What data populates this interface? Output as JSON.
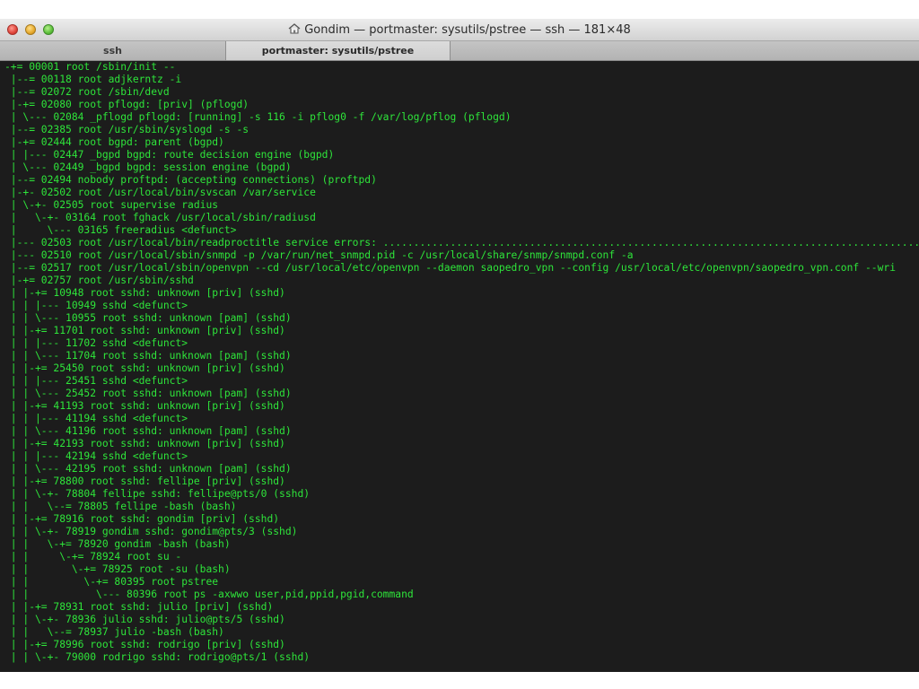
{
  "window": {
    "title": "Gondim — portmaster: sysutils/pstree — ssh — 181×48",
    "colors": {
      "terminal_bg": "#1c1c1c",
      "terminal_fg": "#2ee53a",
      "close": "#e0443a",
      "minimize": "#e6a82b",
      "zoom": "#5cbf3a"
    },
    "title_icon": "home-icon"
  },
  "tabs": [
    {
      "label": "ssh",
      "active": false
    },
    {
      "label": "portmaster: sysutils/pstree",
      "active": true
    }
  ],
  "terminal": {
    "lines": [
      "-+= 00001 root /sbin/init --",
      " |--= 00118 root adjkerntz -i",
      " |--= 02072 root /sbin/devd",
      " |-+= 02080 root pflogd: [priv] (pflogd)",
      " | \\--- 02084 _pflogd pflogd: [running] -s 116 -i pflog0 -f /var/log/pflog (pflogd)",
      " |--= 02385 root /usr/sbin/syslogd -s -s",
      " |-+= 02444 root bgpd: parent (bgpd)",
      " | |--- 02447 _bgpd bgpd: route decision engine (bgpd)",
      " | \\--- 02449 _bgpd bgpd: session engine (bgpd)",
      " |--= 02494 nobody proftpd: (accepting connections) (proftpd)",
      " |-+- 02502 root /usr/local/bin/svscan /var/service",
      " | \\-+- 02505 root supervise radius",
      " |   \\-+- 03164 root fghack /usr/local/sbin/radiusd",
      " |     \\--- 03165 freeradius <defunct>",
      " |--- 02503 root /usr/local/bin/readproctitle service errors: ........................................................................................",
      " |--- 02510 root /usr/local/sbin/snmpd -p /var/run/net_snmpd.pid -c /usr/local/share/snmp/snmpd.conf -a",
      " |--= 02517 root /usr/local/sbin/openvpn --cd /usr/local/etc/openvpn --daemon saopedro_vpn --config /usr/local/etc/openvpn/saopedro_vpn.conf --wri",
      " |-+= 02757 root /usr/sbin/sshd",
      " | |-+= 10948 root sshd: unknown [priv] (sshd)",
      " | | |--- 10949 sshd <defunct>",
      " | | \\--- 10955 root sshd: unknown [pam] (sshd)",
      " | |-+= 11701 root sshd: unknown [priv] (sshd)",
      " | | |--- 11702 sshd <defunct>",
      " | | \\--- 11704 root sshd: unknown [pam] (sshd)",
      " | |-+= 25450 root sshd: unknown [priv] (sshd)",
      " | | |--- 25451 sshd <defunct>",
      " | | \\--- 25452 root sshd: unknown [pam] (sshd)",
      " | |-+= 41193 root sshd: unknown [priv] (sshd)",
      " | | |--- 41194 sshd <defunct>",
      " | | \\--- 41196 root sshd: unknown [pam] (sshd)",
      " | |-+= 42193 root sshd: unknown [priv] (sshd)",
      " | | |--- 42194 sshd <defunct>",
      " | | \\--- 42195 root sshd: unknown [pam] (sshd)",
      " | |-+= 78800 root sshd: fellipe [priv] (sshd)",
      " | | \\-+- 78804 fellipe sshd: fellipe@pts/0 (sshd)",
      " | |   \\--= 78805 fellipe -bash (bash)",
      " | |-+= 78916 root sshd: gondim [priv] (sshd)",
      " | | \\-+- 78919 gondim sshd: gondim@pts/3 (sshd)",
      " | |   \\-+= 78920 gondim -bash (bash)",
      " | |     \\-+= 78924 root su -",
      " | |       \\-+= 78925 root -su (bash)",
      " | |         \\-+= 80395 root pstree",
      " | |           \\--- 80396 root ps -axwwo user,pid,ppid,pgid,command",
      " | |-+= 78931 root sshd: julio [priv] (sshd)",
      " | | \\-+- 78936 julio sshd: julio@pts/5 (sshd)",
      " | |   \\--= 78937 julio -bash (bash)",
      " | |-+= 78996 root sshd: rodrigo [priv] (sshd)",
      " | | \\-+- 79000 rodrigo sshd: rodrigo@pts/1 (sshd)"
    ]
  }
}
